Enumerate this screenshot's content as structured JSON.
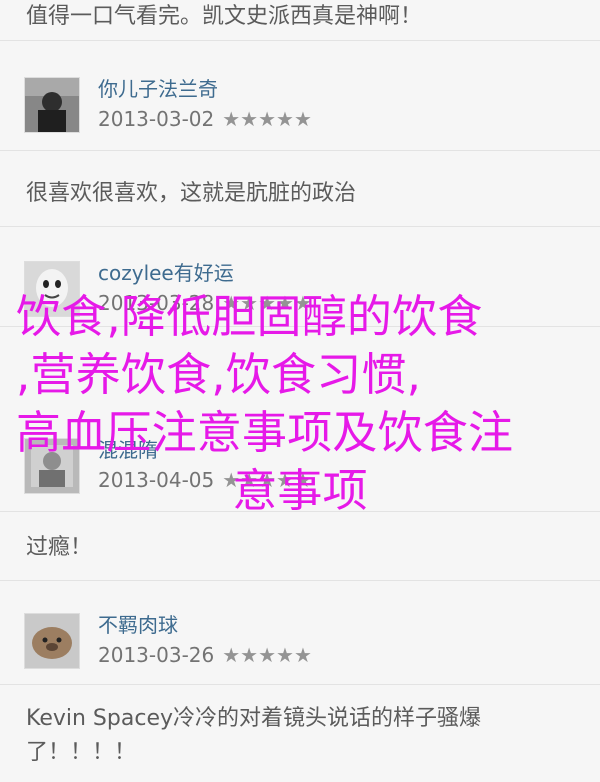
{
  "comments": [
    {
      "text": "值得一口气看完。凯文史派西真是神啊！"
    },
    {
      "text": "很喜欢很喜欢，这就是肮脏的政治"
    },
    {
      "text": "过瘾！"
    },
    {
      "text_line1": "Kevin Spacey冷冷的对着镜头说话的样子骚爆",
      "text_line2": "了！！！！"
    }
  ],
  "reviews": [
    {
      "username": "你儿子法兰奇",
      "date": "2013-03-02",
      "stars": "★★★★★"
    },
    {
      "username": "cozylee有好运",
      "date": "2013-03-28",
      "stars": "★★★★★"
    },
    {
      "username": "混混隋",
      "date": "2013-04-05",
      "stars": "★★★★★"
    },
    {
      "username": "不羁肉球",
      "date": "2013-03-26",
      "stars": "★★★★★"
    }
  ],
  "overlay": {
    "line1": "饮食,降低胆固醇的饮食",
    "line2": ",营养饮食,饮食习惯,",
    "line3": "高血压注意事项及饮食注",
    "line4": "意事项",
    "color": "#e619e8"
  },
  "icons": {
    "avatar1": "avatar-image",
    "avatar2": "avatar-image",
    "avatar3": "avatar-image",
    "avatar4": "avatar-image",
    "star": "star-icon"
  }
}
